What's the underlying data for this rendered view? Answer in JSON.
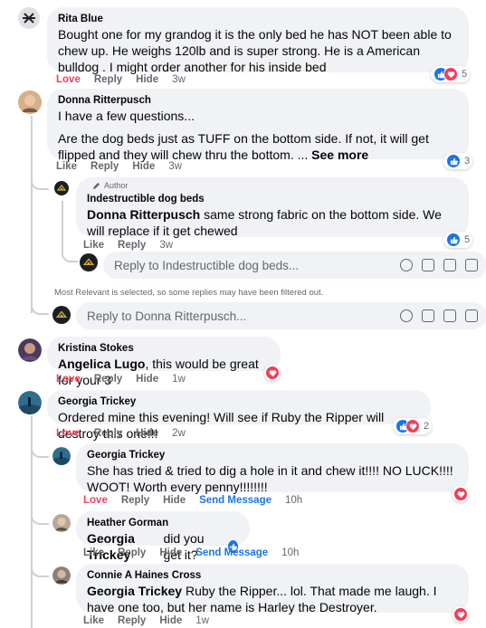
{
  "actions": {
    "love": "Love",
    "like": "Like",
    "reply": "Reply",
    "hide": "Hide",
    "send_message": "Send Message"
  },
  "colors": {
    "love": "#f33e58",
    "like": "#1b74e4",
    "meta": "#65676b",
    "bubble": "#f0f2f5"
  },
  "comments": [
    {
      "author": "Rita Blue",
      "text": "Bought one for my grandog it is the only bed he has NOT been able to chew up. He weighs 120lb and is super strong. He is a American bulldog . I might order another for his inside bed",
      "time": "3w",
      "reaction_count": "5"
    },
    {
      "author": "Donna Ritterpusch",
      "text_line1": "I have a few questions...",
      "text_line2": "Are the dog beds just as TUFF on the bottom side. If not, it will get flipped and they will chew thru the bottom. ...",
      "see_more": "See more",
      "time": "3w",
      "reaction_count": "3",
      "reply": {
        "badge": "Author",
        "author": "Indestructible dog beds",
        "mention": "Donna Ritterpusch",
        "text": "same strong fabric on the bottom side. We will replace if it get chewed",
        "time": "3w",
        "reaction_count": "5",
        "reply_placeholder": "Reply to Indestructible dog beds..."
      }
    },
    {
      "filter_note": "Most Relevant is selected, so some replies may have been filtered out.",
      "reply_placeholder": "Reply to Donna Ritterpusch..."
    },
    {
      "author": "Kristina Stokes",
      "mention": "Angelica Lugo",
      "text": ", this would be great for your 3",
      "time": "1w"
    },
    {
      "author": "Georgia Trickey",
      "text": "Ordered mine this evening! Will see if Ruby the Ripper will destroy this one!!!",
      "time": "2w",
      "reaction_count": "2",
      "replies": [
        {
          "author": "Georgia Trickey",
          "text": "She has tried & tried to dig a hole in it and chew it!!!! NO LUCK!!!! WOOT! Worth every penny!!!!!!!!",
          "time": "10h"
        },
        {
          "author": "Heather Gorman",
          "mention": "Georgia Trickey",
          "text": "did you get it?",
          "time": "10h"
        },
        {
          "author": "Connie A Haines Cross",
          "mention": "Georgia Trickey",
          "text": "Ruby the Ripper... lol. That made me laugh. I have one too, but her name is Harley the Destroyer.",
          "time": "1w"
        }
      ]
    }
  ]
}
